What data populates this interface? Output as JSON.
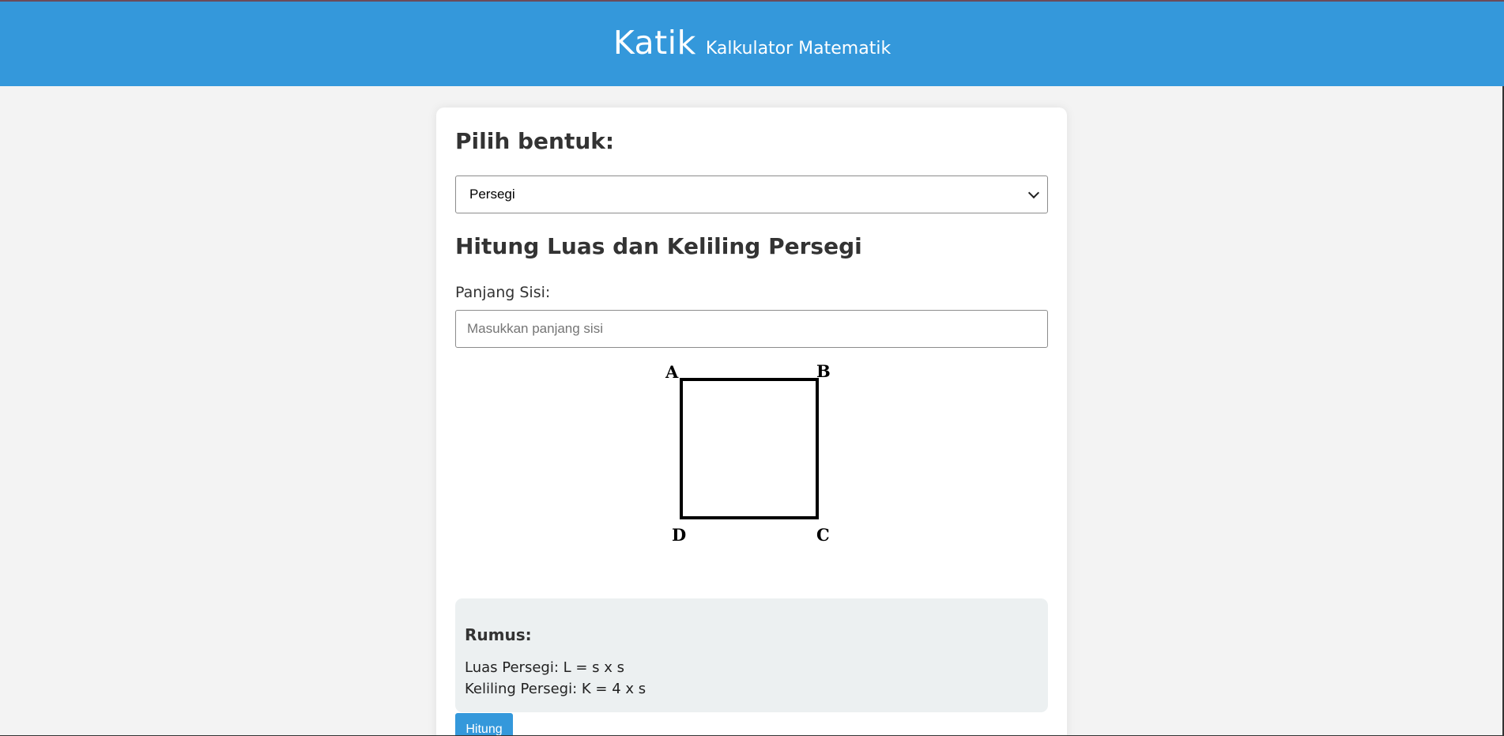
{
  "header": {
    "brand_name": "Katik",
    "brand_subtitle": "Kalkulator Matematik",
    "bg_color": "#3498db"
  },
  "main": {
    "choose_heading": "Pilih bentuk:",
    "shape_select": {
      "selected": "Persegi"
    },
    "calc_heading": "Hitung Luas dan Keliling Persegi",
    "side_label": "Panjang Sisi:",
    "side_input": {
      "value": "",
      "placeholder": "Masukkan panjang sisi"
    },
    "diagram": {
      "vertex_labels": {
        "top_left": "A",
        "top_right": "B",
        "bottom_right": "C",
        "bottom_left": "D"
      }
    },
    "formula": {
      "title": "Rumus:",
      "area": "Luas Persegi: L = s x s",
      "perimeter": "Keliling Persegi: K = 4 x s",
      "bg_color": "#ecf0f1"
    },
    "calculate_button": "Hitung"
  }
}
